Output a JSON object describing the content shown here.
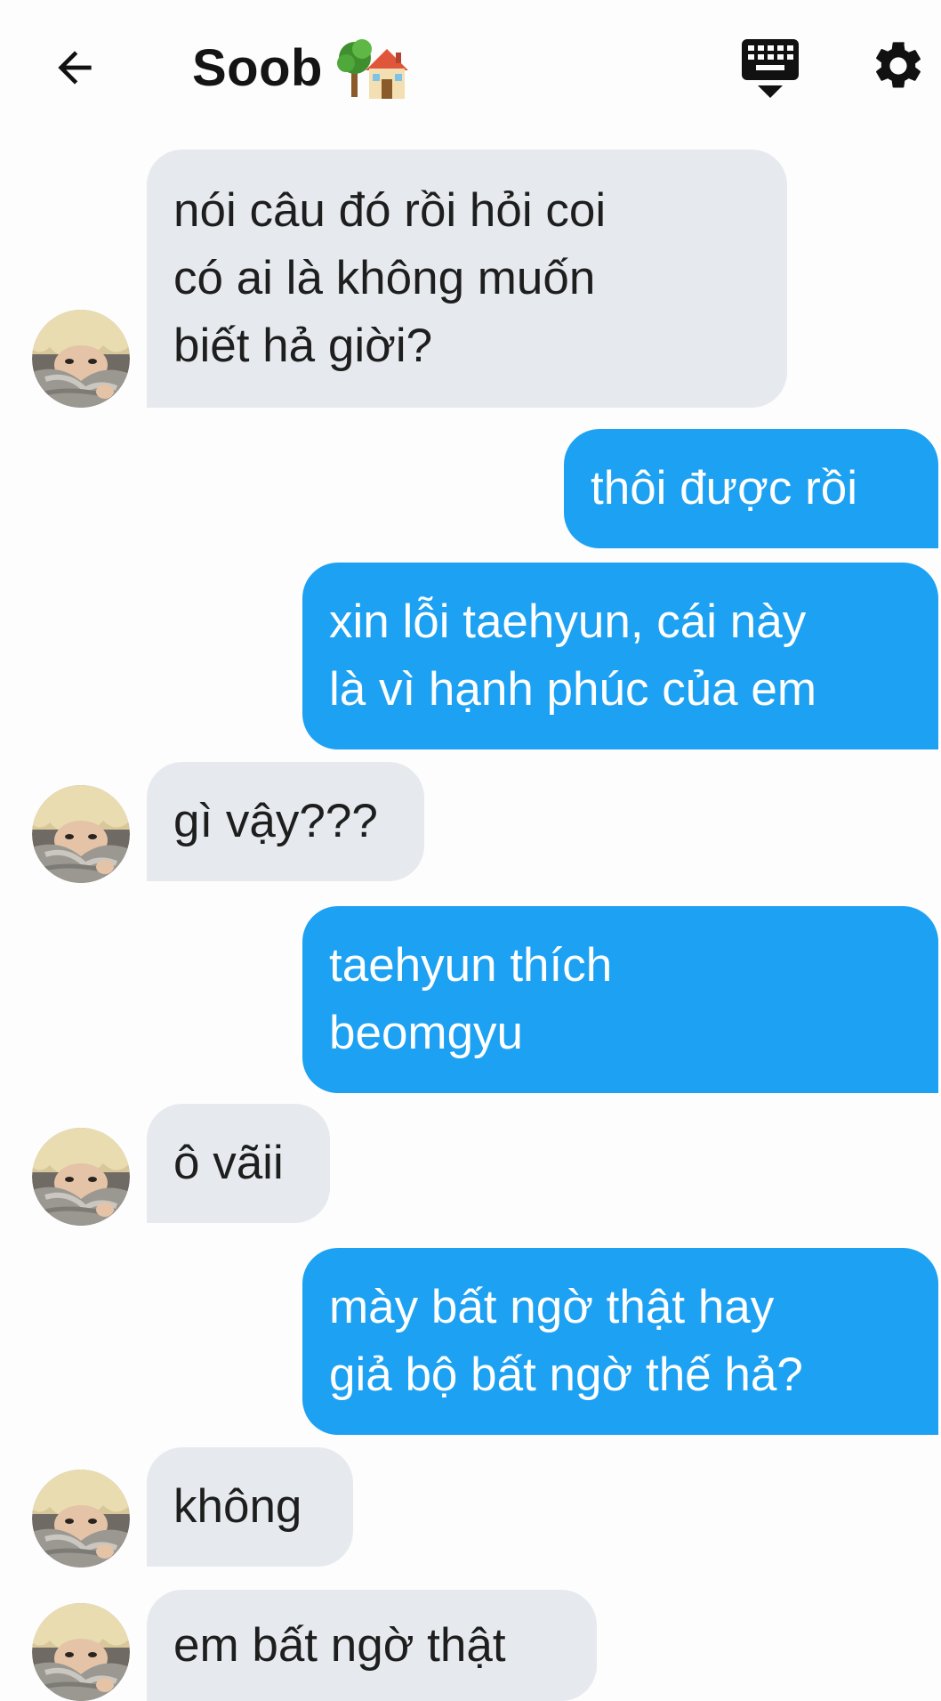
{
  "header": {
    "title": "Soob",
    "title_icon": "tree-house-emoji-icon",
    "back_icon": "back-arrow-icon",
    "keyboard_icon": "keyboard-hide-icon",
    "settings_icon": "gear-icon"
  },
  "colors": {
    "outgoing_bubble": "#1da1f2",
    "incoming_bubble": "#e6eaee",
    "background": "#fdfdfd"
  },
  "messages": [
    {
      "from": "them",
      "text": "nói câu đó rồi hỏi coi\ncó ai là không muốn\nbiết hả giời?"
    },
    {
      "from": "me",
      "text": "thôi được rồi"
    },
    {
      "from": "me",
      "text": "xin lỗi taehyun, cái này\nlà vì hạnh phúc của em"
    },
    {
      "from": "them",
      "text": "gì vậy???"
    },
    {
      "from": "me",
      "text": "taehyun thích\nbeomgyu"
    },
    {
      "from": "them",
      "text": "ô vãii"
    },
    {
      "from": "me",
      "text": "mày bất ngờ thật hay\ngiả bộ bất ngờ thế hả?"
    },
    {
      "from": "them",
      "text": "không"
    },
    {
      "from": "them",
      "text": "em bất ngờ thật"
    }
  ]
}
